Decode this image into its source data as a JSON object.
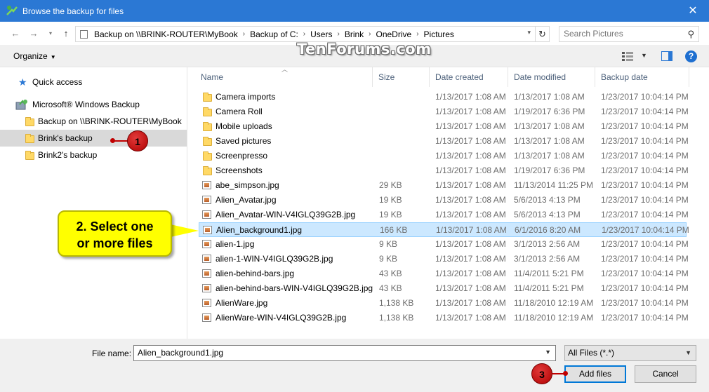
{
  "window": {
    "title": "Browse the backup for files"
  },
  "address": {
    "crumbs": [
      "Backup on \\\\BRINK-ROUTER\\MyBook",
      "Backup of C:",
      "Users",
      "Brink",
      "OneDrive",
      "Pictures"
    ],
    "search_placeholder": "Search Pictures"
  },
  "toolbar": {
    "organize_label": "Organize",
    "help_glyph": "?"
  },
  "watermark": "TenForums.com",
  "nav": {
    "quick_access": "Quick access",
    "windows_backup": "Microsoft® Windows Backup",
    "items": [
      {
        "label": "Backup on \\\\BRINK-ROUTER\\MyBook",
        "selected": false
      },
      {
        "label": "Brink's backup",
        "selected": true
      },
      {
        "label": "Brink2's backup",
        "selected": false
      }
    ]
  },
  "columns": {
    "name": "Name",
    "size": "Size",
    "created": "Date created",
    "modified": "Date modified",
    "backup": "Backup date"
  },
  "files": [
    {
      "name": "Camera imports",
      "type": "folder",
      "size": "",
      "created": "1/13/2017 1:08 AM",
      "modified": "1/13/2017 1:08 AM",
      "backup": "1/23/2017 10:04:14 PM"
    },
    {
      "name": "Camera Roll",
      "type": "folder",
      "size": "",
      "created": "1/13/2017 1:08 AM",
      "modified": "1/19/2017 6:36 PM",
      "backup": "1/23/2017 10:04:14 PM"
    },
    {
      "name": "Mobile uploads",
      "type": "folder",
      "size": "",
      "created": "1/13/2017 1:08 AM",
      "modified": "1/13/2017 1:08 AM",
      "backup": "1/23/2017 10:04:14 PM"
    },
    {
      "name": "Saved pictures",
      "type": "folder",
      "size": "",
      "created": "1/13/2017 1:08 AM",
      "modified": "1/13/2017 1:08 AM",
      "backup": "1/23/2017 10:04:14 PM"
    },
    {
      "name": "Screenpresso",
      "type": "folder",
      "size": "",
      "created": "1/13/2017 1:08 AM",
      "modified": "1/13/2017 1:08 AM",
      "backup": "1/23/2017 10:04:14 PM"
    },
    {
      "name": "Screenshots",
      "type": "folder",
      "size": "",
      "created": "1/13/2017 1:08 AM",
      "modified": "1/19/2017 6:36 PM",
      "backup": "1/23/2017 10:04:14 PM"
    },
    {
      "name": "abe_simpson.jpg",
      "type": "image",
      "size": "29 KB",
      "created": "1/13/2017 1:08 AM",
      "modified": "11/13/2014 11:25 PM",
      "backup": "1/23/2017 10:04:14 PM"
    },
    {
      "name": "Alien_Avatar.jpg",
      "type": "image",
      "size": "19 KB",
      "created": "1/13/2017 1:08 AM",
      "modified": "5/6/2013 4:13 PM",
      "backup": "1/23/2017 10:04:14 PM"
    },
    {
      "name": "Alien_Avatar-WIN-V4IGLQ39G2B.jpg",
      "type": "image",
      "size": "19 KB",
      "created": "1/13/2017 1:08 AM",
      "modified": "5/6/2013 4:13 PM",
      "backup": "1/23/2017 10:04:14 PM"
    },
    {
      "name": "Alien_background1.jpg",
      "type": "image",
      "size": "166 KB",
      "created": "1/13/2017 1:08 AM",
      "modified": "6/1/2016 8:20 AM",
      "backup": "1/23/2017 10:04:14 PM",
      "selected": true
    },
    {
      "name": "alien-1.jpg",
      "type": "image",
      "size": "9 KB",
      "created": "1/13/2017 1:08 AM",
      "modified": "3/1/2013 2:56 AM",
      "backup": "1/23/2017 10:04:14 PM"
    },
    {
      "name": "alien-1-WIN-V4IGLQ39G2B.jpg",
      "type": "image",
      "size": "9 KB",
      "created": "1/13/2017 1:08 AM",
      "modified": "3/1/2013 2:56 AM",
      "backup": "1/23/2017 10:04:14 PM"
    },
    {
      "name": "alien-behind-bars.jpg",
      "type": "image",
      "size": "43 KB",
      "created": "1/13/2017 1:08 AM",
      "modified": "11/4/2011 5:21 PM",
      "backup": "1/23/2017 10:04:14 PM"
    },
    {
      "name": "alien-behind-bars-WIN-V4IGLQ39G2B.jpg",
      "type": "image",
      "size": "43 KB",
      "created": "1/13/2017 1:08 AM",
      "modified": "11/4/2011 5:21 PM",
      "backup": "1/23/2017 10:04:14 PM"
    },
    {
      "name": "AlienWare.jpg",
      "type": "image",
      "size": "1,138 KB",
      "created": "1/13/2017 1:08 AM",
      "modified": "11/18/2010 12:19 AM",
      "backup": "1/23/2017 10:04:14 PM"
    },
    {
      "name": "AlienWare-WIN-V4IGLQ39G2B.jpg",
      "type": "image",
      "size": "1,138 KB",
      "created": "1/13/2017 1:08 AM",
      "modified": "11/18/2010 12:19 AM",
      "backup": "1/23/2017 10:04:14 PM"
    }
  ],
  "footer": {
    "filename_label": "File name:",
    "filename_value": "Alien_background1.jpg",
    "filetype": "All Files (*.*)",
    "add_label": "Add files",
    "cancel_label": "Cancel"
  },
  "annotations": {
    "badge1": "1",
    "badge3": "3",
    "callout_line1": "2. Select one",
    "callout_line2": "or more files"
  },
  "colors": {
    "titlebar": "#2b78d4",
    "selection": "#cce8ff",
    "callout": "#ffff00",
    "badge": "#c00000"
  }
}
